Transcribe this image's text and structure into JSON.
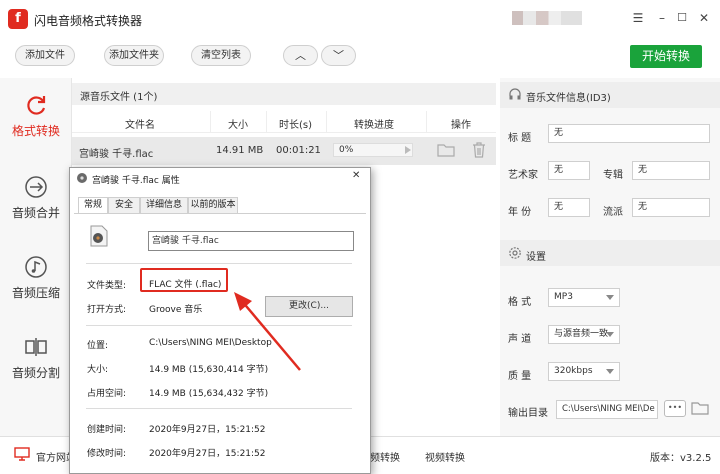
{
  "app": {
    "logo": "f",
    "title": "闪电音频格式转换器"
  },
  "window": {
    "menu": "☰",
    "minimize": "–",
    "maximize": "☐",
    "close": "✕"
  },
  "toolbar": {
    "add_file": "添加文件",
    "add_folder": "添加文件夹",
    "clear_list": "清空列表",
    "move_up": "︿",
    "move_down": "﹀",
    "start": "开始转换"
  },
  "sidebar": {
    "items": [
      {
        "label": "格式转换",
        "icon": "refresh-icon",
        "active": true
      },
      {
        "label": "音频合并",
        "icon": "merge-icon",
        "active": false
      },
      {
        "label": "音频压缩",
        "icon": "music-note-icon",
        "active": false
      },
      {
        "label": "音频分割",
        "icon": "split-icon",
        "active": false
      }
    ]
  },
  "list": {
    "title": "源音乐文件 (1个)",
    "columns": [
      "文件名",
      "大小",
      "时长(s)",
      "转换进度",
      "操作"
    ],
    "rows": [
      {
        "name": "宫崎骏 千寻.flac",
        "size": "14.91 MB",
        "duration": "00:01:21",
        "progress": "0%"
      }
    ]
  },
  "info_panel": {
    "title": "音乐文件信息(ID3)",
    "title_label": "标  题",
    "title_value": "无",
    "artist_label": "艺术家",
    "artist_value": "无",
    "album_label": "专辑",
    "album_value": "无",
    "year_label": "年  份",
    "year_value": "无",
    "genre_label": "流派",
    "genre_value": "无"
  },
  "settings": {
    "title": "设置",
    "format_label": "格  式",
    "format_value": "MP3",
    "channel_label": "声  道",
    "channel_value": "与源音频一致",
    "quality_label": "质  量",
    "quality_value": "320kbps",
    "output_label": "输出目录",
    "output_value": "C:\\Users\\NING MEI\\De",
    "more": "•••"
  },
  "bottom": {
    "official_site": "官方网站",
    "audio_convert": "音频转换",
    "video_convert": "视频转换",
    "version": "版本：v3.2.5"
  },
  "dialog": {
    "title": "宫崎骏 千寻.flac 属性",
    "close": "✕",
    "tabs": [
      "常规",
      "安全",
      "详细信息",
      "以前的版本"
    ],
    "filename": "宫崎骏 千寻.flac",
    "type_label": "文件类型:",
    "type_value": "FLAC 文件 (.flac)",
    "open_label": "打开方式:",
    "open_value": "Groove 音乐",
    "change_button": "更改(C)...",
    "location_label": "位置:",
    "location_value": "C:\\Users\\NING MEI\\Desktop",
    "size_label": "大小:",
    "size_value": "14.9 MB (15,630,414 字节)",
    "disk_label": "占用空间:",
    "disk_value": "14.9 MB (15,634,432 字节)",
    "created_label": "创建时间:",
    "created_value": "2020年9月27日，15:21:52",
    "modified_label": "修改时间:",
    "modified_value": "2020年9月27日，15:21:52"
  },
  "colors": {
    "accent": "#e02b20",
    "start_button": "#1aa33b",
    "highlight_box": "#e02b20"
  }
}
